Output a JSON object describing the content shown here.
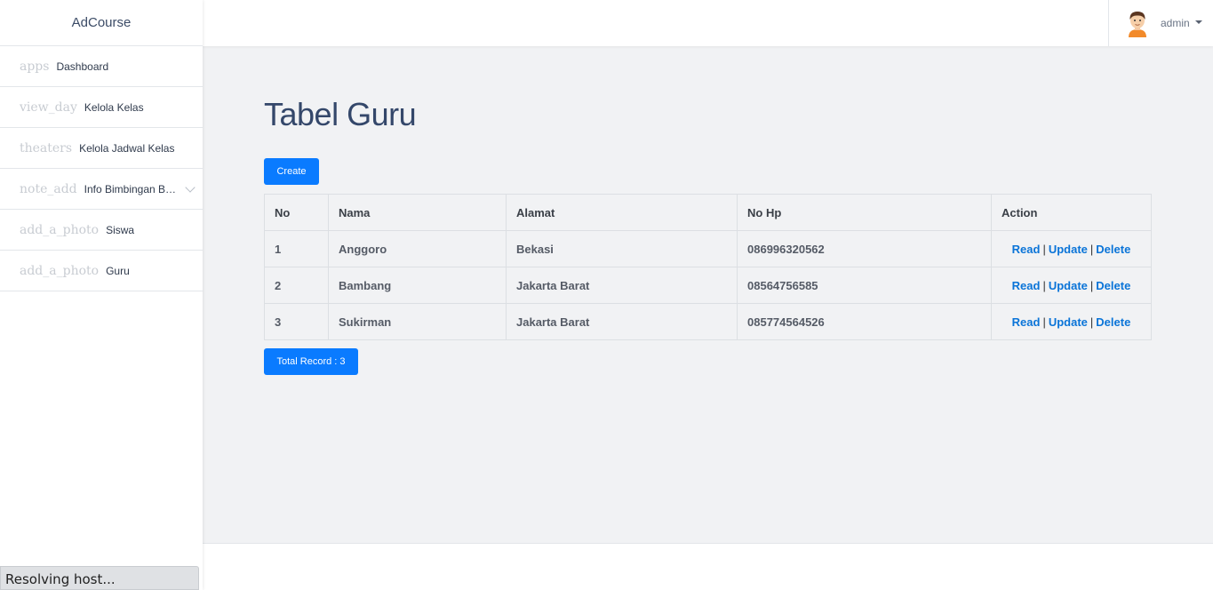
{
  "sidebar": {
    "brand": "AdCourse",
    "items": [
      {
        "icon": "apps",
        "label": "Dashboard"
      },
      {
        "icon": "view_day",
        "label": "Kelola Kelas"
      },
      {
        "icon": "theaters",
        "label": "Kelola Jadwal Kelas"
      },
      {
        "icon": "note_add",
        "label": "Info Bimbingan Belajar"
      },
      {
        "icon": "add_a_photo",
        "label": "Siswa"
      },
      {
        "icon": "add_a_photo",
        "label": "Guru"
      }
    ]
  },
  "topbar": {
    "user_name": "admin"
  },
  "main": {
    "title": "Tabel Guru",
    "create_label": "Create",
    "table": {
      "headers": [
        "No",
        "Nama",
        "Alamat",
        "No Hp",
        "Action"
      ],
      "rows": [
        {
          "no": "1",
          "nama": "Anggoro",
          "alamat": "Bekasi",
          "hp": "086996320562"
        },
        {
          "no": "2",
          "nama": "Bambang",
          "alamat": "Jakarta Barat",
          "hp": "08564756585"
        },
        {
          "no": "3",
          "nama": "Sukirman",
          "alamat": "Jakarta Barat",
          "hp": "085774564526"
        }
      ],
      "actions": {
        "read": "Read",
        "update": "Update",
        "delete": "Delete",
        "separator": "|"
      }
    },
    "total_label": "Total Record : 3"
  },
  "status_bar": "Resolving host...",
  "colors": {
    "primary": "#0a7bff",
    "link": "#0a74d8",
    "title": "#34476a"
  }
}
